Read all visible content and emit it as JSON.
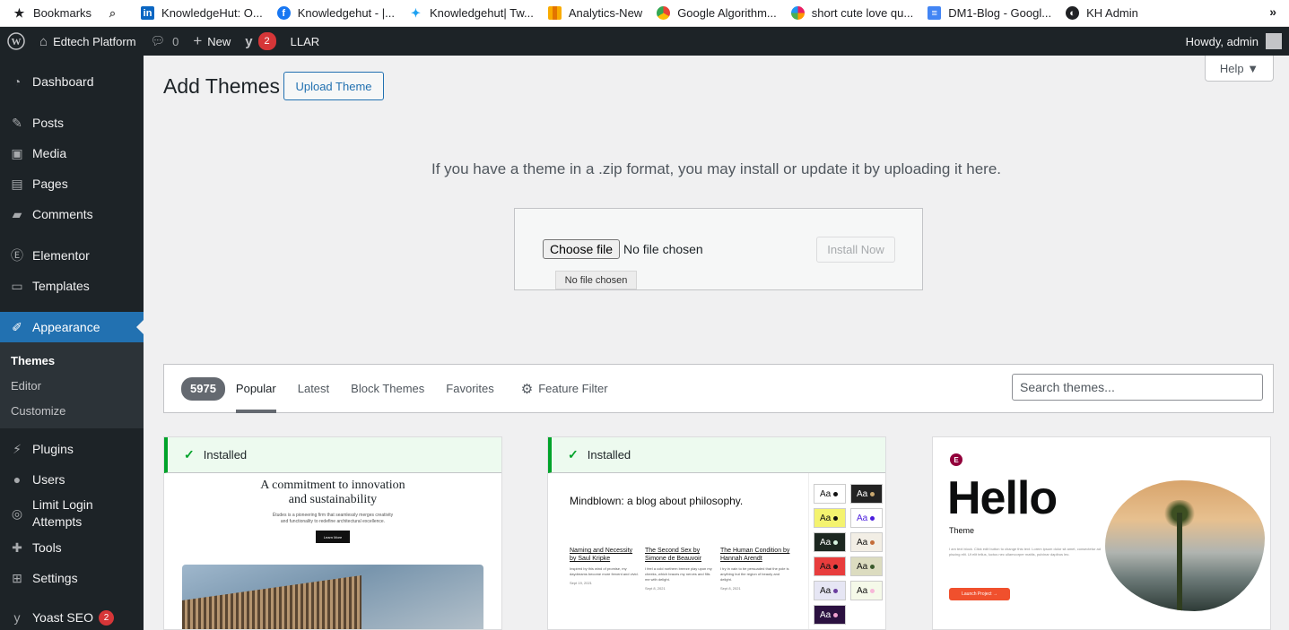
{
  "bookmarks": {
    "items": [
      {
        "label": "Bookmarks",
        "icon": "star-icon"
      },
      {
        "label": "",
        "icon": "search-icon"
      },
      {
        "label": "KnowledgeHut: O...",
        "icon": "linkedin-icon"
      },
      {
        "label": "Knowledgehut - |...",
        "icon": "facebook-icon"
      },
      {
        "label": "Knowledgehut| Tw...",
        "icon": "twitter-icon"
      },
      {
        "label": "Analytics-New",
        "icon": "analytics-icon"
      },
      {
        "label": "Google Algorithm...",
        "icon": "chrome-icon"
      },
      {
        "label": "short cute love qu...",
        "icon": "pinwheel-icon"
      },
      {
        "label": "DM1-Blog - Googl...",
        "icon": "google-docs-icon"
      },
      {
        "label": "KH Admin",
        "icon": "globe-icon"
      }
    ],
    "more": "»"
  },
  "adminbar": {
    "site_name": "Edtech Platform",
    "comments_count": "0",
    "new_label": "New",
    "yoast_badge": "2",
    "llar": "LLAR",
    "howdy": "Howdy, admin"
  },
  "sidebar": {
    "items": [
      {
        "label": "Dashboard",
        "icon": "dashboard-icon"
      },
      {
        "label": "Posts",
        "icon": "pin-icon"
      },
      {
        "label": "Media",
        "icon": "media-icon"
      },
      {
        "label": "Pages",
        "icon": "pages-icon"
      },
      {
        "label": "Comments",
        "icon": "comment-icon"
      },
      {
        "label": "Elementor",
        "icon": "elementor-icon"
      },
      {
        "label": "Templates",
        "icon": "folder-icon"
      },
      {
        "label": "Appearance",
        "icon": "brush-icon"
      },
      {
        "label": "Plugins",
        "icon": "plugin-icon"
      },
      {
        "label": "Users",
        "icon": "user-icon"
      },
      {
        "label": "Limit Login Attempts",
        "icon": "fingerprint-icon"
      },
      {
        "label": "Tools",
        "icon": "wrench-icon"
      },
      {
        "label": "Settings",
        "icon": "settings-icon"
      },
      {
        "label": "Yoast SEO",
        "icon": "yoast-icon",
        "badge": "2"
      }
    ],
    "submenu": [
      "Themes",
      "Editor",
      "Customize"
    ]
  },
  "main": {
    "help": "Help ▼",
    "title": "Add Themes",
    "upload_button": "Upload Theme",
    "upload_desc": "If you have a theme in a .zip format, you may install or update it by uploading it here.",
    "choose_file": "Choose file",
    "no_file": "No file chosen",
    "tooltip": "No file chosen",
    "install_now": "Install Now"
  },
  "filter": {
    "count": "5975",
    "tabs": [
      "Popular",
      "Latest",
      "Block Themes",
      "Favorites"
    ],
    "feature_filter": "Feature Filter",
    "search_placeholder": "Search themes..."
  },
  "cards": {
    "installed_label": "Installed",
    "card1": {
      "title_line1": "A commitment to innovation",
      "title_line2": "and sustainability",
      "sub_line1": "Études is a pioneering firm that seamlessly merges creativity",
      "sub_line2": "and functionality to redefine architectural excellence.",
      "button": "Learn More"
    },
    "card2": {
      "headline": "Mindblown: a blog about philosophy.",
      "posts": [
        {
          "title": "Naming and Necessity by Saul Kripke",
          "desc": "Inspired by this wind of promise, my daydreams become more fervent and vivid.",
          "date": "Sept 19, 2021"
        },
        {
          "title": "The Second Sex by Simone de Beauvoir",
          "desc": "I feel a cold northern breeze play upon my cheeks, which braces my nerves and fills me with delight.",
          "date": "Sept 8, 2021"
        },
        {
          "title": "The Human Condition by Hannah Arendt",
          "desc": "I try in vain to be persuaded that the pole is anything but the region of beauty and delight.",
          "date": "Sept 8, 2021"
        }
      ],
      "swatch_label": "Aa"
    },
    "card3": {
      "logo": "E",
      "hello": "Hello",
      "theme": "Theme",
      "text": "I am text block. Click edit button to change this text. Lorem ipsum dolor sit amet, consectetur ad piscing elit. Ut elit tellus, luctus nec ullamcorper mattis, pulvinar dapibus leo.",
      "button": "Launch Project →"
    }
  },
  "colors": {
    "admin_dark": "#1d2327",
    "accent": "#2271b1",
    "installed_green": "#00a32a",
    "badge_red": "#d63638"
  }
}
